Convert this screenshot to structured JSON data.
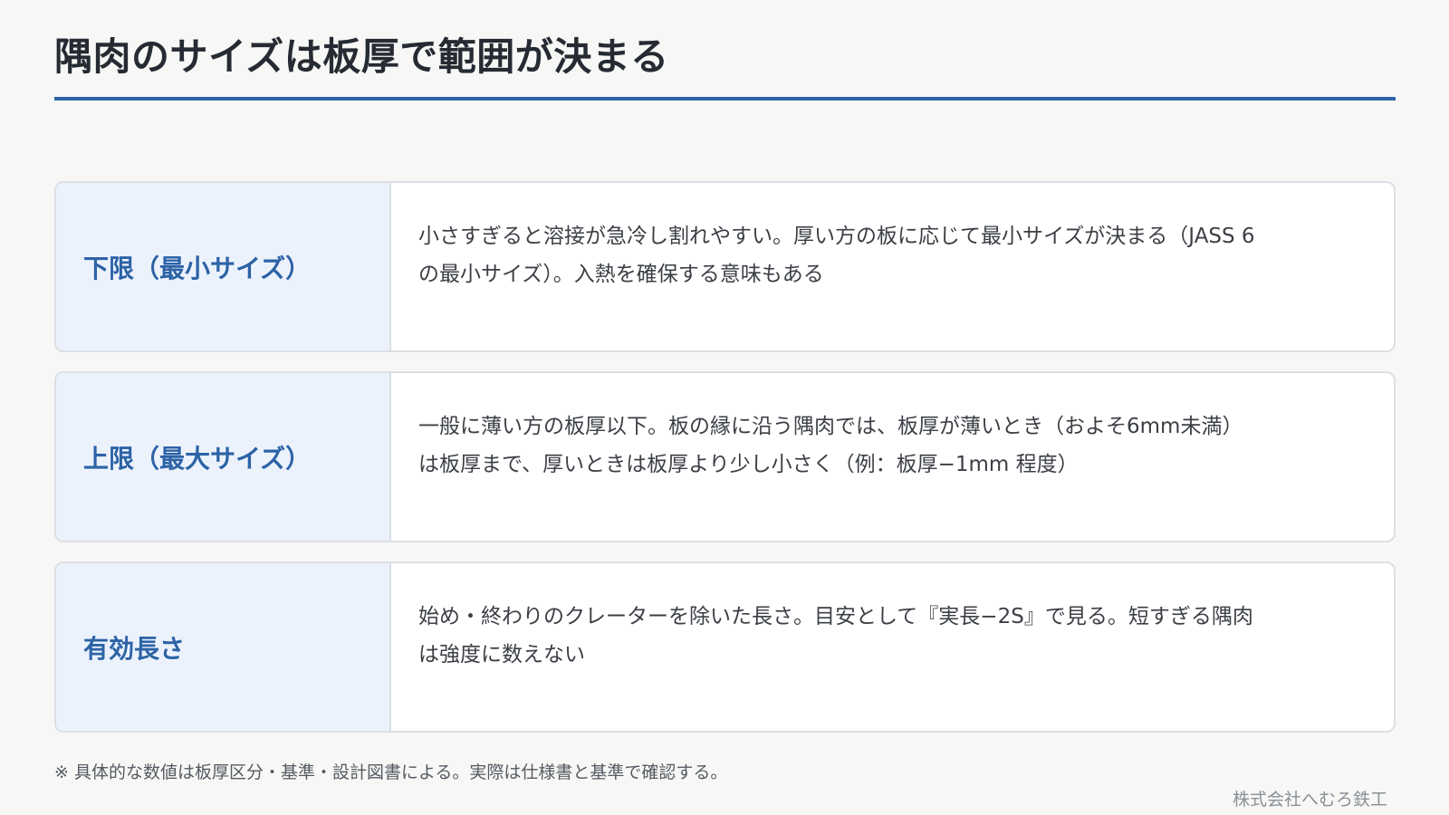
{
  "slide": {
    "title": "隅肉のサイズは板厚で範囲が決まる",
    "rows": [
      {
        "label": "下限（最小サイズ）",
        "text": "小さすぎると溶接が急冷し割れやすい。厚い方の板に応じて最小サイズが決まる（JASS 6 の最小サイズ）。入熱を確保する意味もある"
      },
      {
        "label": "上限（最大サイズ）",
        "text": "一般に薄い方の板厚以下。板の縁に沿う隅肉では、板厚が薄いとき（およそ6mm未満）は板厚まで、厚いときは板厚より少し小さく（例：板厚−1mm 程度）"
      },
      {
        "label": "有効長さ",
        "text": "始め・終わりのクレーターを除いた長さ。目安として『実長−2S』で見る。短すぎる隅肉は強度に数えない"
      }
    ],
    "footnote": "※ 具体的な数値は板厚区分・基準・設計図書による。実際は仕様書と基準で確認する。",
    "company": "株式会社へむろ鉄工"
  },
  "colors": {
    "accent": "#2d63a6",
    "label_background": "#ecf2fc",
    "page_background": "#f7f8f6"
  }
}
